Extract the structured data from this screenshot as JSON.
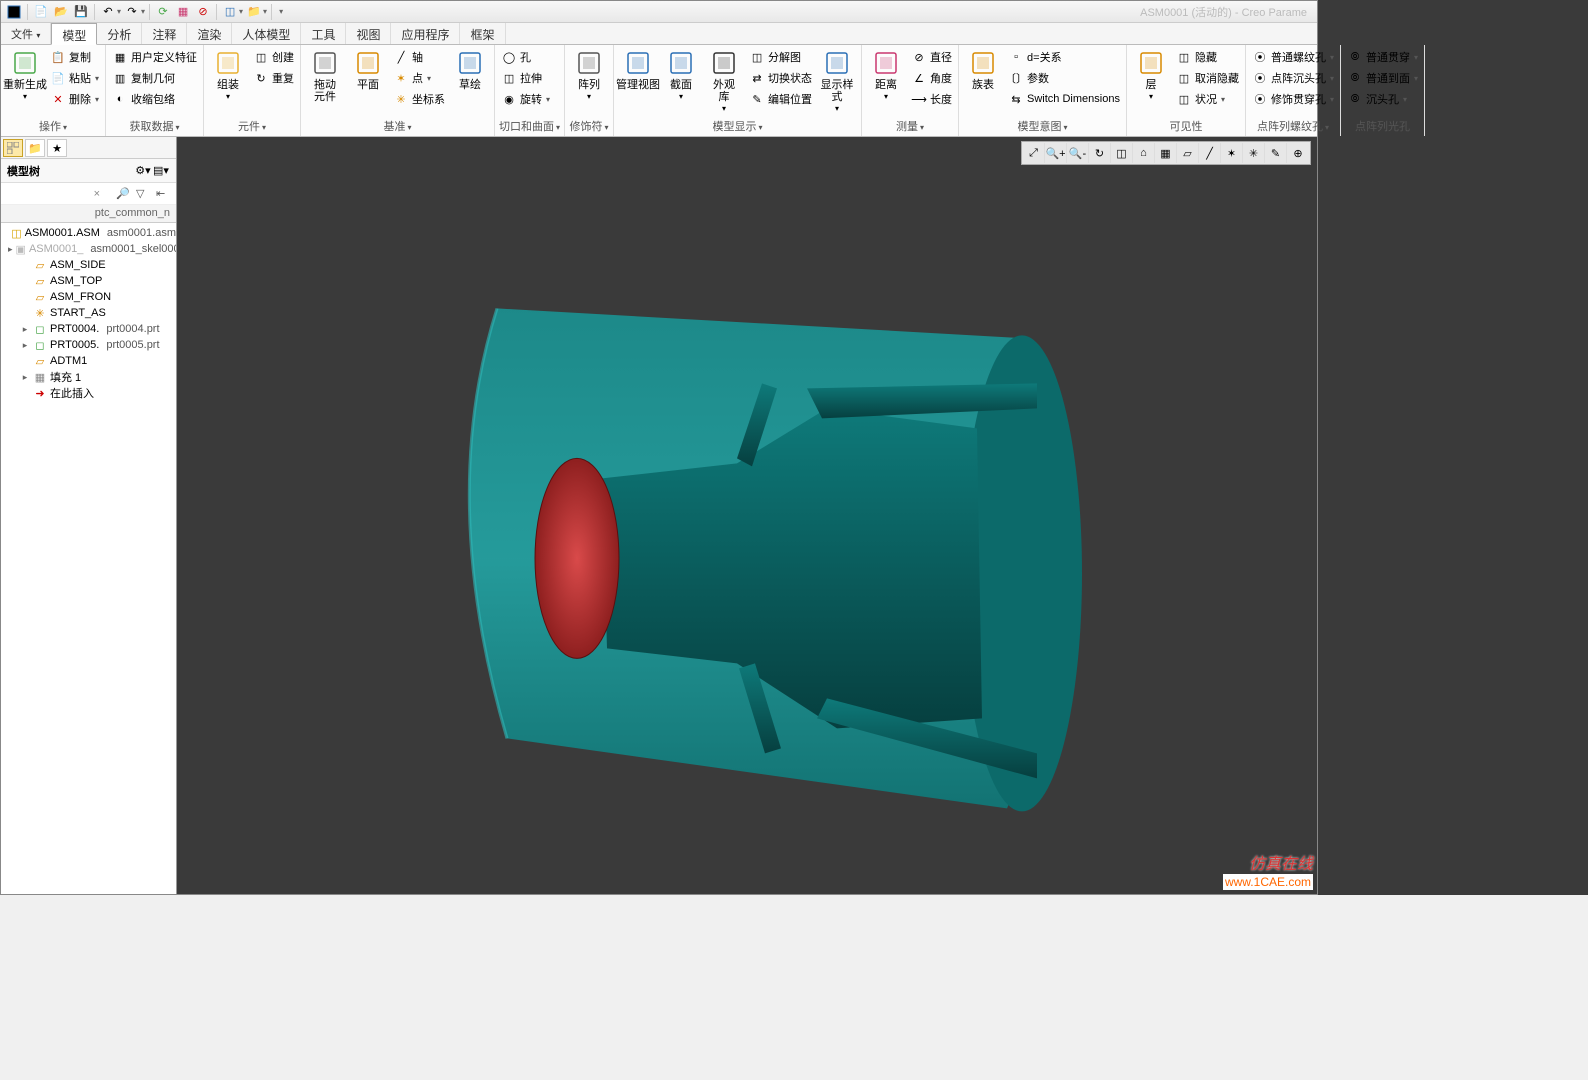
{
  "title": "ASM0001 (活动的) - Creo Parame",
  "tabs": [
    "文件",
    "模型",
    "分析",
    "注释",
    "渲染",
    "人体模型",
    "工具",
    "视图",
    "应用程序",
    "框架"
  ],
  "active_tab": 1,
  "ribbon": {
    "groups": [
      {
        "label": "操作",
        "drop": true,
        "items": {
          "big": [
            {
              "name": "regen",
              "label": "重新生成",
              "drop": true,
              "color": "#4aa84a"
            }
          ],
          "col": [
            {
              "name": "copy",
              "label": "复制",
              "ico": "📋"
            },
            {
              "name": "paste",
              "label": "粘贴",
              "drop": true,
              "ico": "📄"
            },
            {
              "name": "delete",
              "label": "删除",
              "drop": true,
              "ico": "✕",
              "c": "#c00"
            }
          ]
        }
      },
      {
        "label": "获取数据",
        "drop": true,
        "items": {
          "col": [
            {
              "name": "udf",
              "label": "用户定义特征",
              "ico": "▦"
            },
            {
              "name": "copygeom",
              "label": "复制几何",
              "ico": "▥"
            },
            {
              "name": "shrink",
              "label": "收缩包络",
              "ico": "◐"
            }
          ]
        }
      },
      {
        "label": "元件",
        "drop": true,
        "items": {
          "big": [
            {
              "name": "assemble",
              "label": "组装",
              "drop": true,
              "color": "#e8b030"
            }
          ],
          "col": [
            {
              "name": "create",
              "label": "创建",
              "ico": "◫"
            },
            {
              "name": "repeat",
              "label": "重复",
              "ico": "↻"
            }
          ]
        }
      },
      {
        "label": "基准",
        "drop": true,
        "items": {
          "big": [
            {
              "name": "dragcomp",
              "label": "拖动",
              "label2": "元件",
              "color": "#555"
            },
            {
              "name": "plane",
              "label": "平面",
              "color": "#d88a00"
            }
          ],
          "col": [
            {
              "name": "axis",
              "label": "轴",
              "ico": "╱"
            },
            {
              "name": "point",
              "label": "点",
              "drop": true,
              "ico": "✶",
              "c": "#d88a00"
            },
            {
              "name": "csys",
              "label": "坐标系",
              "ico": "✳",
              "c": "#d88a00"
            }
          ],
          "big2": [
            {
              "name": "sketch",
              "label": "草绘",
              "color": "#2a6eb5"
            }
          ]
        }
      },
      {
        "label": "切口和曲面",
        "drop": true,
        "items": {
          "col": [
            {
              "name": "hole",
              "label": "孔",
              "ico": "◯"
            },
            {
              "name": "extrude",
              "label": "拉伸",
              "ico": "◫"
            },
            {
              "name": "revolve",
              "label": "旋转",
              "drop": true,
              "ico": "◉"
            }
          ]
        }
      },
      {
        "label": "修饰符",
        "drop": true,
        "items": {
          "big": [
            {
              "name": "pattern",
              "label": "阵列",
              "drop": true,
              "color": "#555"
            }
          ]
        }
      },
      {
        "label": "模型显示",
        "drop": true,
        "items": {
          "big": [
            {
              "name": "mgrview",
              "label": "管理视图",
              "color": "#2a6eb5"
            },
            {
              "name": "section",
              "label": "截面",
              "drop": true,
              "color": "#2a6eb5"
            },
            {
              "name": "appear",
              "label": "外观",
              "label2": "库",
              "drop": true,
              "color": "#333"
            }
          ],
          "col": [
            {
              "name": "explode",
              "label": "分解图",
              "ico": "◫"
            },
            {
              "name": "togstate",
              "label": "切换状态",
              "ico": "⇄"
            },
            {
              "name": "editpos",
              "label": "编辑位置",
              "ico": "✎"
            }
          ],
          "big2": [
            {
              "name": "dispstyle",
              "label": "显示样",
              "label2": "式",
              "drop": true,
              "color": "#2a6eb5"
            }
          ]
        }
      },
      {
        "label": "测量",
        "drop": true,
        "items": {
          "big": [
            {
              "name": "distance",
              "label": "距离",
              "drop": true,
              "color": "#c9376e"
            }
          ],
          "col": [
            {
              "name": "diameter",
              "label": "直径",
              "ico": "⊘"
            },
            {
              "name": "angle",
              "label": "角度",
              "ico": "∠"
            },
            {
              "name": "length",
              "label": "长度",
              "ico": "⟶"
            }
          ]
        }
      },
      {
        "label": "模型意图",
        "drop": true,
        "items": {
          "big": [
            {
              "name": "famtable",
              "label": "族表",
              "color": "#d88a00"
            }
          ],
          "col": [
            {
              "name": "relation",
              "label": "d=关系",
              "ico": ""
            },
            {
              "name": "param",
              "label": "参数",
              "ico": "〔〕"
            },
            {
              "name": "switchdim",
              "label": "Switch Dimensions",
              "ico": "⇆"
            }
          ]
        }
      },
      {
        "label": "可见性",
        "items": {
          "big": [
            {
              "name": "layer",
              "label": "层",
              "drop": true,
              "color": "#d88a00"
            }
          ],
          "col": [
            {
              "name": "hide",
              "label": "隐藏",
              "ico": "◫"
            },
            {
              "name": "unhide",
              "label": "取消隐藏",
              "ico": "◫"
            },
            {
              "name": "status",
              "label": "状况",
              "drop": true,
              "ico": "◫"
            }
          ]
        }
      },
      {
        "label": "点阵列螺纹孔",
        "drop": true,
        "items": {
          "col": [
            {
              "name": "thread-pt",
              "label": "普通螺纹孔",
              "drop": true,
              "ico": "⦿"
            },
            {
              "name": "csunk-pt",
              "label": "点阵沉头孔",
              "drop": true,
              "ico": "⦿"
            },
            {
              "name": "cthrd-pt",
              "label": "修饰贯穿孔",
              "drop": true,
              "ico": "⦿"
            }
          ]
        }
      },
      {
        "label": "点阵列光孔",
        "items": {
          "col": [
            {
              "name": "through",
              "label": "普通贯穿",
              "drop": true,
              "ico": "⦾"
            },
            {
              "name": "toface",
              "label": "普通到面",
              "drop": true,
              "ico": "⦾"
            },
            {
              "name": "csunk",
              "label": "沉头孔",
              "drop": true,
              "ico": "⦾"
            }
          ]
        }
      }
    ]
  },
  "sidebar": {
    "title": "模型树",
    "hdr_cols": [
      "",
      "ptc_common_n"
    ],
    "tree": [
      {
        "lvl": 0,
        "tw": "",
        "ico": "◫",
        "c": "#d8a400",
        "text": "ASM0001.ASM",
        "extra": "asm0001.asm"
      },
      {
        "lvl": 1,
        "tw": "▸",
        "ico": "▣",
        "c": "#bbb",
        "text": "ASM0001_",
        "extra": "asm0001_skel000",
        "gray": true
      },
      {
        "lvl": 1,
        "tw": "",
        "ico": "▱",
        "c": "#d88a00",
        "text": "ASM_SIDE"
      },
      {
        "lvl": 1,
        "tw": "",
        "ico": "▱",
        "c": "#d88a00",
        "text": "ASM_TOP"
      },
      {
        "lvl": 1,
        "tw": "",
        "ico": "▱",
        "c": "#d88a00",
        "text": "ASM_FRON"
      },
      {
        "lvl": 1,
        "tw": "",
        "ico": "✳",
        "c": "#d88a00",
        "text": "START_AS"
      },
      {
        "lvl": 1,
        "tw": "▸",
        "ico": "◻",
        "c": "#3a9d3a",
        "text": "PRT0004.",
        "extra": "prt0004.prt"
      },
      {
        "lvl": 1,
        "tw": "▸",
        "ico": "◻",
        "c": "#3a9d3a",
        "text": "PRT0005.",
        "extra": "prt0005.prt"
      },
      {
        "lvl": 1,
        "tw": "",
        "ico": "▱",
        "c": "#d88a00",
        "text": "ADTM1"
      },
      {
        "lvl": 1,
        "tw": "▸",
        "ico": "▦",
        "c": "#888",
        "text": "填充 1"
      },
      {
        "lvl": 1,
        "tw": "",
        "ico": "➜",
        "c": "#c00",
        "text": "在此插入"
      }
    ]
  },
  "watermark": {
    "l1": "仿真在线",
    "l2": "www.1CAE.com"
  }
}
